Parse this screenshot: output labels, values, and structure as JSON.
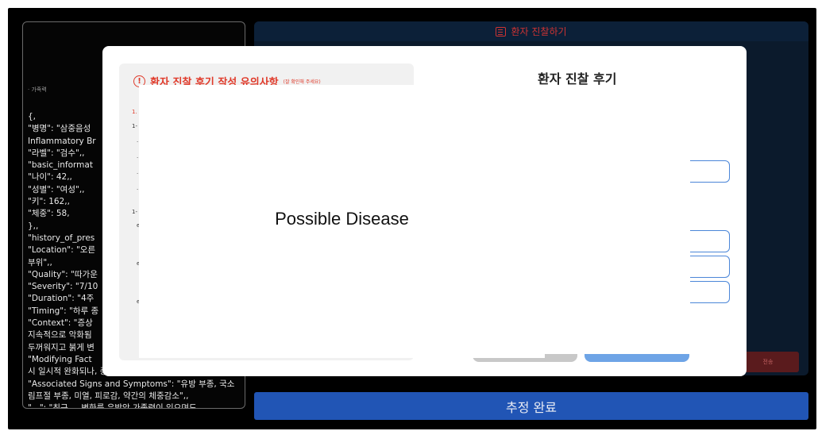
{
  "json_panel": {
    "small_label": "· 가족력",
    "lines": [
      "{,",
      "\"병명\": \"삼중음성",
      "Inflammatory Br",
      "\"라벨\": \"검수\",,",
      "\"basic_informat",
      "\"나이\": 42,,",
      "\"성별\": \"여성\",,",
      "\"키\": 162,,",
      "\"체중\": 58,",
      "},,",
      "\"history_of_pres",
      "\"Location\": \"오른",
      "부위\",,",
      "\"Quality\": \"따가운",
      "\"Severity\": \"7/10",
      "\"Duration\": \"4주",
      "\"Timing\": \"하루 종",
      "\"Context\": \"증상",
      "지속적으로 악화됨",
      "두꺼워지고 붉게 변",
      "\"Modifying Fact",
      "시 일시적 완화되나, 증상의 전반적 개선은 없음\",,",
      "\"Associated Signs and Symptoms\": \"유방 부종, 국소",
      "림프절 부종, 미열, 피로감, 약간의 체중감소\",,",
      "\"...\": \"최근 ... 변화를 유방암 가족력이 있으며도"
    ]
  },
  "app": {
    "header_title": "환자 진찰하기",
    "send_label": "전송",
    "estimate_label": "추정 완료"
  },
  "modal": {
    "notes_title": "환자 진찰 후기 작성 유의사항",
    "notes_subtitle": "(잘 확인해 주세요)",
    "notes_items": [
      "1.",
      "1-",
      "·",
      "·",
      "·",
      "·",
      "1-",
      "e",
      "e",
      "e"
    ],
    "title": "환자 진찰 후기"
  },
  "overlay": {
    "text": "Possible Disease"
  }
}
